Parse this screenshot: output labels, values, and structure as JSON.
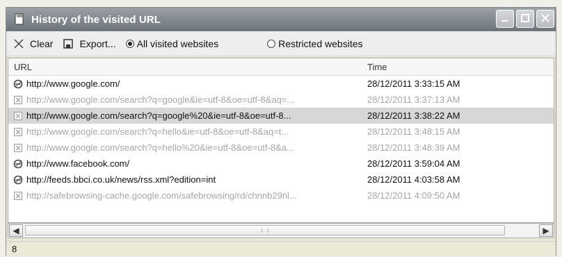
{
  "window": {
    "title": "History of the visited URL",
    "app_icon": "book-icon",
    "controls": [
      "minimize-icon",
      "maximize-icon",
      "close-icon"
    ]
  },
  "toolbar": {
    "clear_label": "Clear",
    "export_label": "Export...",
    "filter_all_label": "All visited websites",
    "filter_restricted_label": "Restricted websites",
    "selected_filter": "All visited websites"
  },
  "list": {
    "columns": [
      "URL",
      "Time"
    ],
    "rows": [
      {
        "url": "http://www.google.com/",
        "time": "28/12/2011 3:33:15 AM",
        "icon": "ie-page-icon",
        "state": "normal"
      },
      {
        "url": "http://www.google.com/search?q=google&ie=utf-8&oe=utf-8&aq=...",
        "time": "28/12/2011 3:37:13 AM",
        "icon": "blocked-page-icon",
        "state": "dim"
      },
      {
        "url": "http://www.google.com/search?q=google%20&ie=utf-8&oe=utf-8...",
        "time": "28/12/2011 3:38:22 AM",
        "icon": "blocked-page-icon",
        "state": "selected"
      },
      {
        "url": "http://www.google.com/search?q=hello&ie=utf-8&oe=utf-8&aq=t...",
        "time": "28/12/2011 3:48:15 AM",
        "icon": "blocked-page-icon",
        "state": "dim"
      },
      {
        "url": "http://www.google.com/search?q=hello%20&ie=utf-8&oe=utf-8&a...",
        "time": "28/12/2011 3:48:39 AM",
        "icon": "blocked-page-icon",
        "state": "dim"
      },
      {
        "url": "http://www.facebook.com/",
        "time": "28/12/2011 3:59:04 AM",
        "icon": "ie-page-icon",
        "state": "normal"
      },
      {
        "url": "http://feeds.bbci.co.uk/news/rss.xml?edition=int",
        "time": "28/12/2011 4:03:58 AM",
        "icon": "ie-page-icon",
        "state": "normal"
      },
      {
        "url": "http://safebrowsing-cache.google.com/safebrowsing/rd/chnnb29nl...",
        "time": "28/12/2011 4:09:50 AM",
        "icon": "blocked-page-icon",
        "state": "dim"
      }
    ]
  },
  "status": {
    "count": "8"
  },
  "colors": {
    "titlebar": "#7f858c",
    "selected_row": "#d7d7d7",
    "dim_text": "#a6a6a6"
  }
}
